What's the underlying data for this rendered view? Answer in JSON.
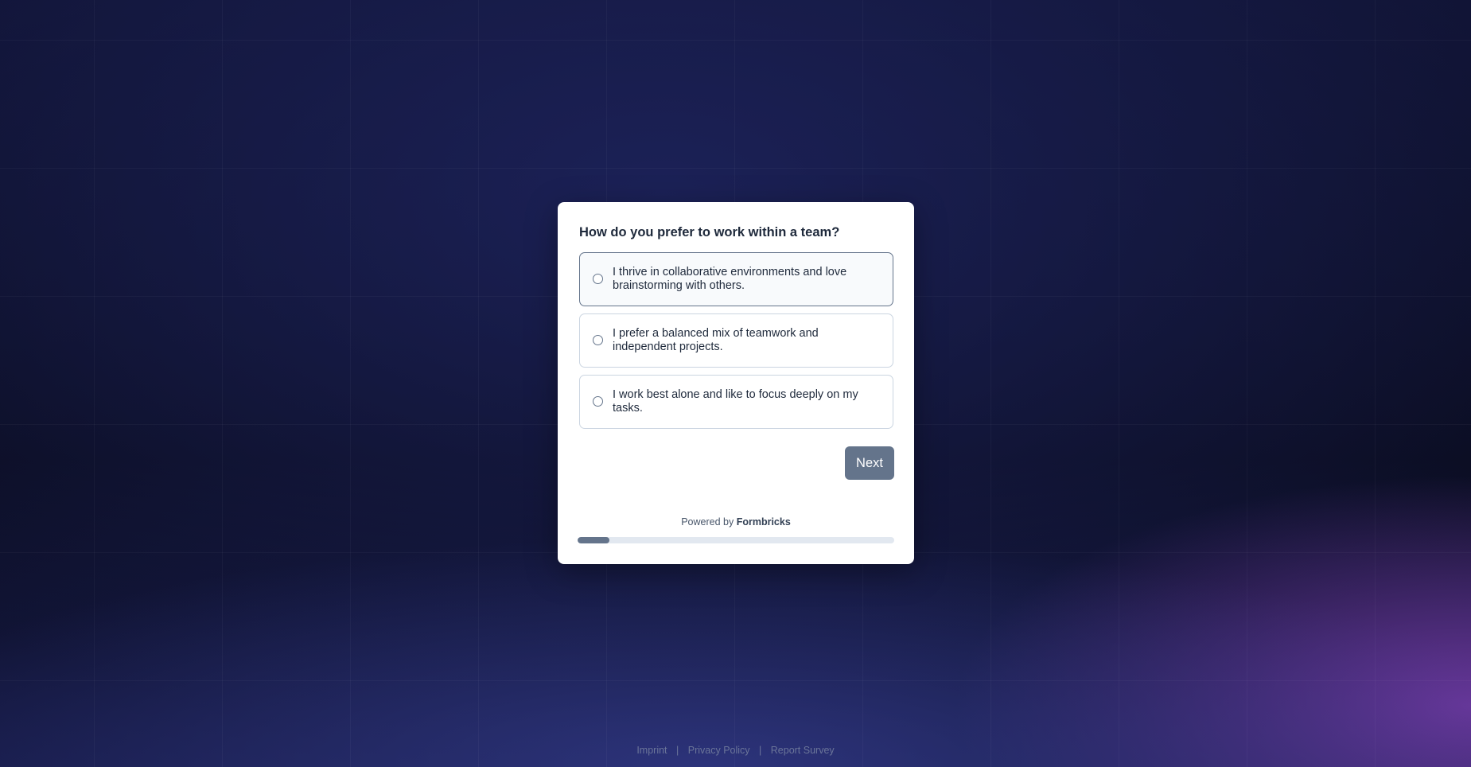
{
  "survey": {
    "question": "How do you prefer to work within a team?",
    "options": [
      {
        "label": "I thrive in collaborative environments and love brainstorming with others."
      },
      {
        "label": "I prefer a balanced mix of teamwork and independent projects."
      },
      {
        "label": "I work best alone and like to focus deeply on my tasks."
      }
    ],
    "next_label": "Next",
    "powered_by_prefix": "Powered by",
    "powered_by_brand": "Formbricks",
    "progress_percent": 10
  },
  "footer": {
    "links": [
      {
        "label": "Imprint"
      },
      {
        "label": "Privacy Policy"
      },
      {
        "label": "Report Survey"
      }
    ],
    "separator": "|"
  },
  "colors": {
    "brand": "#64748b",
    "card_background": "#ffffff",
    "page_background": "#0c0f24"
  }
}
